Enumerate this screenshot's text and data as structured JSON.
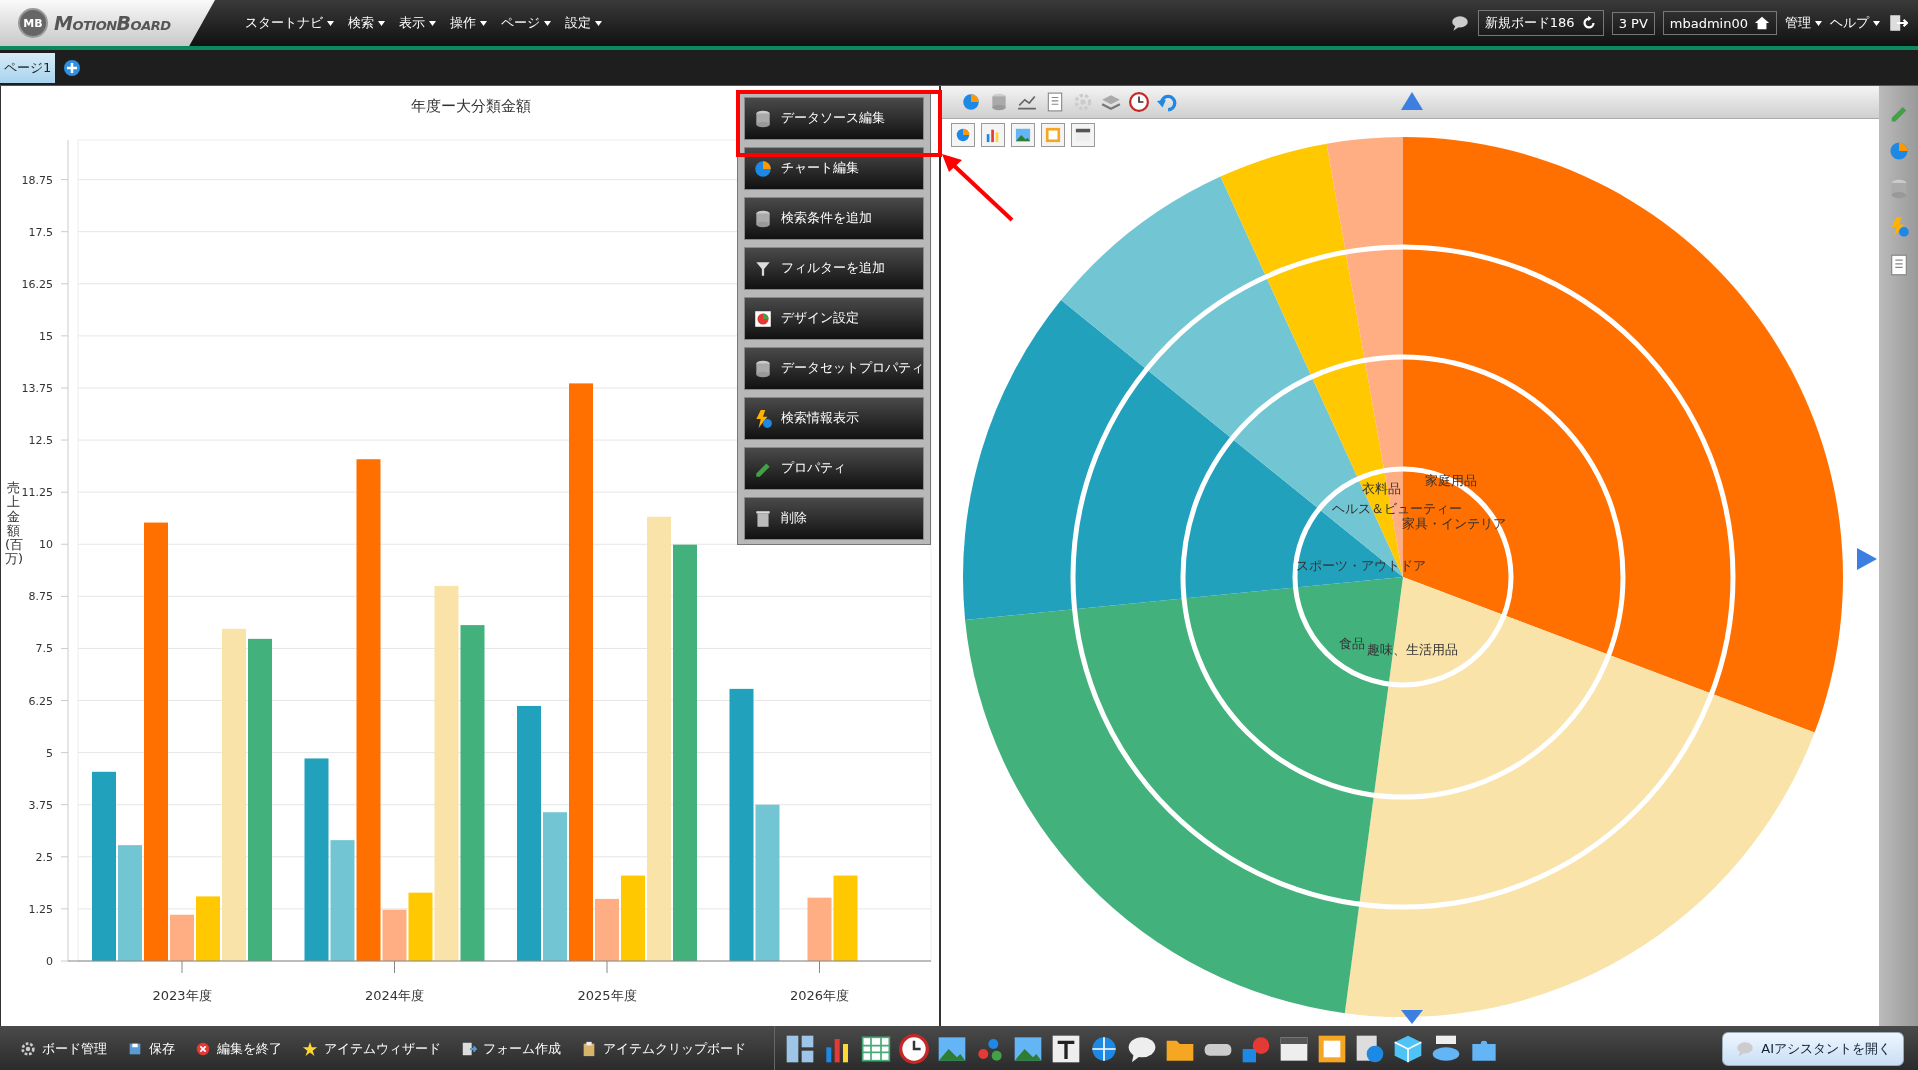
{
  "header": {
    "logo_badge": "MB",
    "logo": "MotionBoard",
    "menus": [
      {
        "label": "スタートナビ"
      },
      {
        "label": "検索"
      },
      {
        "label": "表示"
      },
      {
        "label": "操作"
      },
      {
        "label": "ページ"
      },
      {
        "label": "設定"
      }
    ],
    "board": "新規ボード186",
    "pv": "3 PV",
    "user": "mbadmin00",
    "right_menus": [
      {
        "label": "管理"
      },
      {
        "label": "ヘルプ"
      }
    ]
  },
  "page_tabs": [
    {
      "label": "ページ1",
      "selected": true
    }
  ],
  "bar_chart": {
    "chart_data": {
      "type": "bar",
      "title": "年度ー大分類金額",
      "ylabel": "売上金額(百万)",
      "categories": [
        "2023年度",
        "2024年度",
        "2025年度",
        "2026年度"
      ],
      "series": [
        {
          "color": "#22a1bd",
          "values": [
            4.54,
            4.86,
            6.12,
            6.53
          ]
        },
        {
          "color": "#72c5d3",
          "values": [
            2.78,
            2.9,
            3.57,
            3.75
          ]
        },
        {
          "color": "#ff7000",
          "values": [
            10.52,
            12.04,
            13.86,
            null
          ]
        },
        {
          "color": "#ffad82",
          "values": [
            1.11,
            1.23,
            1.49,
            1.52
          ]
        },
        {
          "color": "#ffc800",
          "values": [
            1.55,
            1.64,
            2.05,
            2.05
          ]
        },
        {
          "color": "#f9e3a9",
          "values": [
            7.97,
            9.0,
            10.66,
            null
          ]
        },
        {
          "color": "#43b17c",
          "values": [
            7.73,
            8.06,
            9.99,
            null
          ]
        }
      ],
      "grid": true,
      "ylim": [
        0,
        19.7
      ],
      "yticks": [
        0,
        1.25,
        2.5,
        3.75,
        5,
        6.25,
        7.5,
        8.75,
        10,
        11.25,
        12.5,
        13.75,
        15,
        16.25,
        17.5,
        18.75
      ]
    }
  },
  "context_menu": {
    "items": [
      {
        "label": "データソース編集",
        "highlighted": true
      },
      {
        "label": "チャート編集",
        "highlighted": false
      },
      {
        "label": "検索条件を追加",
        "highlighted": false
      },
      {
        "label": "フィルターを追加",
        "highlighted": false
      },
      {
        "label": "デザイン設定",
        "highlighted": false
      },
      {
        "label": "データセットプロパティ",
        "highlighted": false
      },
      {
        "label": "検索情報表示",
        "highlighted": false
      },
      {
        "label": "プロパティ",
        "highlighted": false
      },
      {
        "label": "削除",
        "highlighted": false
      }
    ]
  },
  "donut_labels": [
    "家庭用品",
    "衣料品",
    "ヘルス＆ビューティー",
    "家具・インテリア",
    "スポーツ・アウトドア",
    "食品",
    "趣味、生活用品"
  ],
  "bottom_toolbar": {
    "items": [
      {
        "label": "ボード管理"
      },
      {
        "label": "保存"
      },
      {
        "label": "編集を終了"
      },
      {
        "label": "アイテムウィザード"
      },
      {
        "label": "フォーム作成"
      },
      {
        "label": "アイテムクリップボード"
      }
    ],
    "assistant": "AIアシスタントを開く"
  }
}
